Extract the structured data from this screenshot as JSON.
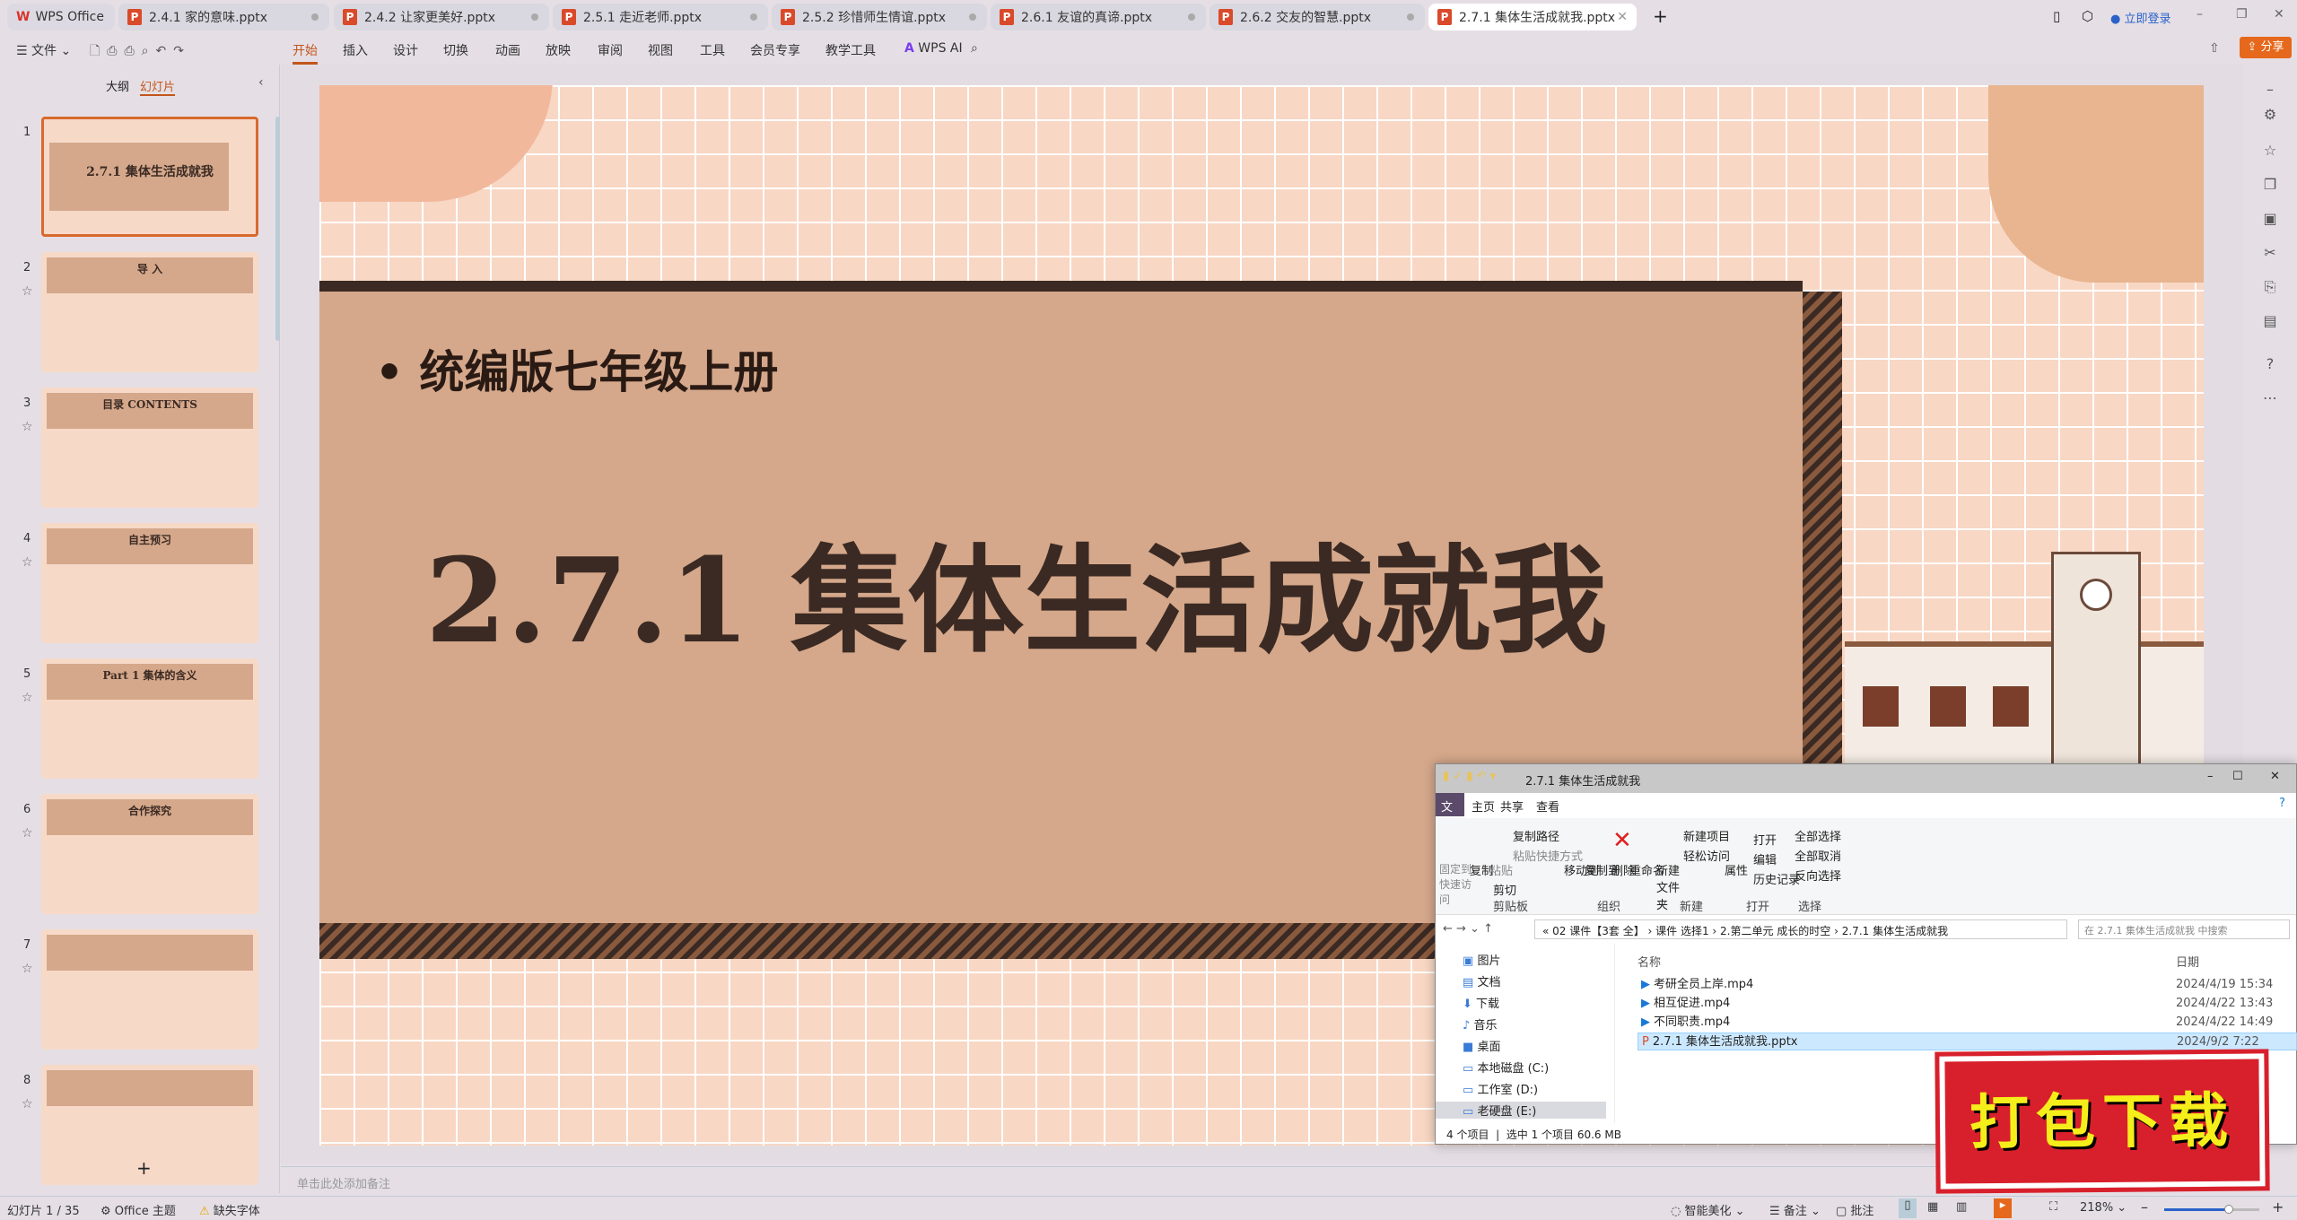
{
  "app": {
    "name": "WPS Office",
    "colors": {
      "accent": "#c2561c",
      "share": "#e5681c",
      "explorer_selected": "#cce8ff",
      "stamp": "#d8202c"
    }
  },
  "tabs": [
    {
      "label": "2.4.1 家的意味.pptx"
    },
    {
      "label": "2.4.2 让家更美好.pptx"
    },
    {
      "label": "2.5.1 走近老师.pptx"
    },
    {
      "label": "2.5.2 珍惜师生情谊.pptx"
    },
    {
      "label": "2.6.1 友谊的真谛.pptx"
    },
    {
      "label": "2.6.2 交友的智慧.pptx"
    },
    {
      "label": "2.7.1 集体生活成就我.pptx",
      "active": true
    }
  ],
  "titlebar": {
    "login": "立即登录",
    "share": "分享"
  },
  "menu": {
    "file": "文件",
    "items": [
      "开始",
      "插入",
      "设计",
      "切换",
      "动画",
      "放映",
      "审阅",
      "视图",
      "工具",
      "会员专享",
      "教学工具"
    ],
    "active": "开始",
    "ai": "WPS AI"
  },
  "leftpanel": {
    "tab_outline": "大纲",
    "tab_slides": "幻灯片",
    "add": "+"
  },
  "thumbnails": [
    {
      "num": "1",
      "title": "2.7.1 集体生活成就我"
    },
    {
      "num": "2",
      "title": "导 入"
    },
    {
      "num": "3",
      "title": "目录 CONTENTS"
    },
    {
      "num": "4",
      "title": "自主预习"
    },
    {
      "num": "5",
      "title": "Part 1 集体的含义"
    },
    {
      "num": "6",
      "title": "合作探究"
    },
    {
      "num": "7",
      "title": ""
    },
    {
      "num": "8",
      "title": ""
    }
  ],
  "slide": {
    "bullet": "统编版七年级上册",
    "title": "2.7.1 集体生活成就我"
  },
  "notes": {
    "placeholder": "单击此处添加备注"
  },
  "status": {
    "slide": "幻灯片 1 / 35",
    "theme": "Office 主题",
    "missing_font": "缺失字体",
    "beautify": "智能美化",
    "notes": "备注",
    "comments": "批注",
    "zoom": "218%",
    "zoom_level": 0.68
  },
  "explorer": {
    "title": "2.7.1 集体生活成就我",
    "ribbon_tabs": [
      "文件",
      "主页",
      "共享",
      "查看"
    ],
    "ribbon": {
      "pin": "固定到快速访问",
      "copy": "复制",
      "paste": "粘贴",
      "copy_path": "复制路径",
      "paste_shortcut": "粘贴快捷方式",
      "cut": "剪切",
      "move_to": "移动到",
      "copy_to": "复制到",
      "delete": "删除",
      "rename": "重命名",
      "new_folder": "新建文件夹",
      "new_item": "新建项目",
      "easy_access": "轻松访问",
      "properties": "属性",
      "open": "打开",
      "edit": "编辑",
      "history": "历史记录",
      "select_all": "全部选择",
      "select_none": "全部取消",
      "invert": "反向选择"
    },
    "groups": [
      "剪贴板",
      "组织",
      "新建",
      "打开",
      "选择"
    ],
    "breadcrumb": [
      "02 课件【3套 全】",
      "课件 选择1",
      "2.第二单元 成长的时空",
      "2.7.1 集体生活成就我"
    ],
    "search_placeholder": "在 2.7.1 集体生活成就我 中搜索",
    "nav": [
      "图片",
      "文档",
      "下载",
      "音乐",
      "桌面",
      "本地磁盘 (C:)",
      "工作室 (D:)",
      "老硬盘 (E:)"
    ],
    "columns": {
      "name": "名称",
      "date": "日期"
    },
    "files": [
      {
        "name": "考研全员上岸.mp4",
        "date": "2024/4/19 15:34",
        "type": "video"
      },
      {
        "name": "相互促进.mp4",
        "date": "2024/4/22 13:43",
        "type": "video"
      },
      {
        "name": "不同职责.mp4",
        "date": "2024/4/22 14:49",
        "type": "video"
      },
      {
        "name": "2.7.1 集体生活成就我.pptx",
        "date": "2024/9/2 7:22",
        "type": "pptx",
        "selected": true
      }
    ],
    "status_count": "4 个项目",
    "status_selected": "选中 1 个项目  60.6 MB"
  },
  "stamp": {
    "text": "打包下载"
  }
}
